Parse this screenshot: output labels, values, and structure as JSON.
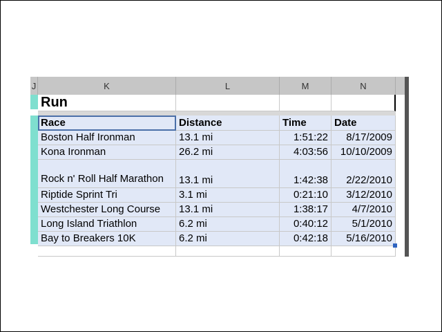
{
  "spreadsheet": {
    "column_headers": [
      "J",
      "K",
      "L",
      "M",
      "N"
    ],
    "title": "Run",
    "table_headers": [
      "Race",
      "Distance",
      "Time",
      "Date"
    ],
    "rows": [
      {
        "race": "Boston Half Ironman",
        "distance": "13.1 mi",
        "time": "1:51:22",
        "date": "8/17/2009"
      },
      {
        "race": "Kona Ironman",
        "distance": "26.2 mi",
        "time": "4:03:56",
        "date": "10/10/2009"
      },
      {
        "race": "Rock n' Roll Half Marathon",
        "distance": "13.1 mi",
        "time": "1:42:38",
        "date": "2/22/2010"
      },
      {
        "race": "Riptide Sprint Tri",
        "distance": "3.1 mi",
        "time": "0:21:10",
        "date": "3/12/2010"
      },
      {
        "race": "Westchester Long Course",
        "distance": "13.1 mi",
        "time": "1:38:17",
        "date": "4/7/2010"
      },
      {
        "race": "Long Island Triathlon",
        "distance": "6.2 mi",
        "time": "0:40:12",
        "date": "5/1/2010"
      },
      {
        "race": "Bay to Breakers 10K",
        "distance": "6.2 mi",
        "time": "0:42:18",
        "date": "5/16/2010"
      }
    ]
  },
  "colors": {
    "selection_fill": "#e1e8f7",
    "header_bar": "#c6c6c6",
    "row_gutter_selected": "#7fdfcf",
    "fill_handle": "#2f64c0"
  }
}
